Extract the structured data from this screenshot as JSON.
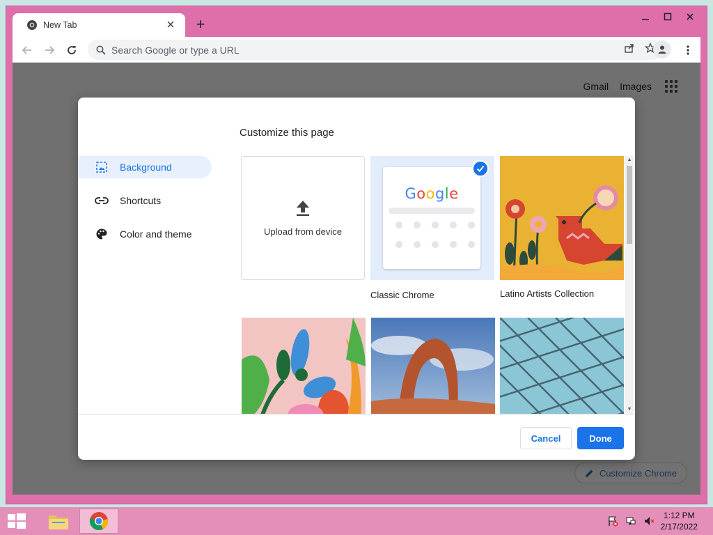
{
  "window": {
    "minimize_glyph": "🗕",
    "maximize_glyph": "🗖",
    "close_glyph": "✕"
  },
  "tab": {
    "title": "New Tab",
    "close_glyph": "✕",
    "new_tab_glyph": "+"
  },
  "toolbar": {
    "address_placeholder": "Search Google or type a URL"
  },
  "page": {
    "links": [
      "Gmail",
      "Images"
    ],
    "customize_chrome_label": "Customize Chrome"
  },
  "dialog": {
    "title": "Customize this page",
    "menu": [
      {
        "label": "Background",
        "icon": "image-icon",
        "active": true
      },
      {
        "label": "Shortcuts",
        "icon": "link-icon",
        "active": false
      },
      {
        "label": "Color and theme",
        "icon": "palette-icon",
        "active": false
      }
    ],
    "tiles": {
      "upload_label": "Upload from device",
      "classic_label": "Classic Chrome",
      "classic_logo": "Google",
      "latino_label": "Latino Artists Collection"
    },
    "cancel_label": "Cancel",
    "done_label": "Done"
  },
  "taskbar": {
    "time": "1:12 PM",
    "date": "2/17/2022"
  },
  "colors": {
    "accent": "#1a73e8",
    "window_frame": "#de6faa",
    "taskbar": "#e48fba"
  }
}
